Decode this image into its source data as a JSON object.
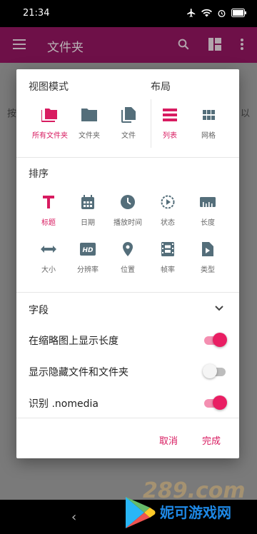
{
  "status_bar": {
    "time": "21:34"
  },
  "app_bar": {
    "title": "文件夹"
  },
  "background": {
    "left_text": "按",
    "right_text": "以"
  },
  "dialog": {
    "view_mode": {
      "title": "视图模式",
      "options": [
        {
          "label": "所有文件夹",
          "icon": "folders-icon",
          "selected": true
        },
        {
          "label": "文件夹",
          "icon": "folder-icon",
          "selected": false
        },
        {
          "label": "文件",
          "icon": "files-icon",
          "selected": false
        }
      ]
    },
    "layout": {
      "title": "布局",
      "options": [
        {
          "label": "列表",
          "icon": "list-icon",
          "selected": true
        },
        {
          "label": "网格",
          "icon": "grid-icon",
          "selected": false
        }
      ]
    },
    "sort": {
      "title": "排序",
      "options": [
        {
          "label": "标题",
          "icon": "title-icon",
          "selected": true
        },
        {
          "label": "日期",
          "icon": "calendar-icon",
          "selected": false
        },
        {
          "label": "播放时间",
          "icon": "clock-icon",
          "selected": false
        },
        {
          "label": "状态",
          "icon": "status-icon",
          "selected": false
        },
        {
          "label": "长度",
          "icon": "ruler-icon",
          "selected": false
        },
        {
          "label": "大小",
          "icon": "size-icon",
          "selected": false
        },
        {
          "label": "分辨率",
          "icon": "hd-icon",
          "selected": false
        },
        {
          "label": "位置",
          "icon": "location-icon",
          "selected": false
        },
        {
          "label": "帧率",
          "icon": "framerate-icon",
          "selected": false
        },
        {
          "label": "类型",
          "icon": "filetype-icon",
          "selected": false
        }
      ]
    },
    "fields": {
      "label": "字段"
    },
    "toggles": [
      {
        "label": "在缩略图上显示长度",
        "on": true
      },
      {
        "label": "显示隐藏文件和文件夹",
        "on": false
      },
      {
        "label": "识别 .nomedia",
        "on": true
      }
    ],
    "buttons": {
      "cancel": "取消",
      "done": "完成"
    }
  },
  "watermark": {
    "text": "妮可游戏网",
    "number": "289.com"
  },
  "colors": {
    "accent": "#d81b60",
    "icon": "#546e7a"
  }
}
